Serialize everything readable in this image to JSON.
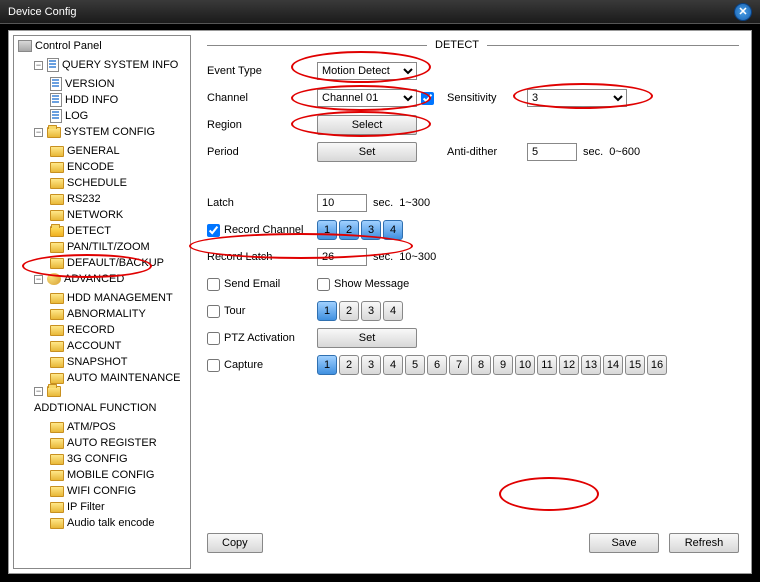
{
  "window": {
    "title": "Device Config"
  },
  "tree": {
    "root": "Control Panel",
    "groups": [
      {
        "label": "QUERY SYSTEM INFO",
        "icon": "page",
        "children": [
          "VERSION",
          "HDD INFO",
          "LOG"
        ]
      },
      {
        "label": "SYSTEM CONFIG",
        "icon": "folder",
        "children": [
          "GENERAL",
          "ENCODE",
          "SCHEDULE",
          "RS232",
          "NETWORK",
          "DETECT",
          "PAN/TILT/ZOOM",
          "DEFAULT/BACKUP"
        ]
      },
      {
        "label": "ADVANCED",
        "icon": "adv",
        "children": [
          "HDD MANAGEMENT",
          "ABNORMALITY",
          "RECORD",
          "ACCOUNT",
          "SNAPSHOT",
          "AUTO MAINTENANCE"
        ]
      },
      {
        "label": "ADDTIONAL FUNCTION",
        "icon": "folder",
        "children": [
          "ATM/POS",
          "AUTO REGISTER",
          "3G CONFIG",
          "MOBILE CONFIG",
          "WIFI CONFIG",
          "IP Filter",
          "Audio talk encode"
        ]
      }
    ]
  },
  "detect": {
    "heading": "DETECT",
    "labels": {
      "eventType": "Event Type",
      "channel": "Channel",
      "sensitivity": "Sensitivity",
      "region": "Region",
      "period": "Period",
      "antiDither": "Anti-dither",
      "sec": "sec.",
      "antiDitherRange": "0~600",
      "latch": "Latch",
      "latchRange": "1~300",
      "recordChannel": "Record Channel",
      "recordLatch": "Record Latch",
      "recordLatchRange": "10~300",
      "sendEmail": "Send Email",
      "showMessage": "Show Message",
      "tour": "Tour",
      "ptz": "PTZ Activation",
      "capture": "Capture"
    },
    "values": {
      "eventType": "Motion Detect",
      "channel": "Channel 01",
      "channelChecked": true,
      "sensitivity": "3",
      "regionBtn": "Select",
      "periodBtn": "Set",
      "antiDither": "5",
      "latch": "10",
      "recordChannelChecked": true,
      "recordChannels": [
        "1",
        "2",
        "3",
        "4"
      ],
      "recordChannelsSelected": [
        true,
        true,
        true,
        true
      ],
      "recordLatch": "26",
      "sendEmail": false,
      "showMessage": false,
      "tour": false,
      "tourChannels": [
        "1",
        "2",
        "3",
        "4"
      ],
      "tourSelected": [
        true,
        false,
        false,
        false
      ],
      "ptz": false,
      "ptzBtn": "Set",
      "capture": false,
      "captureChannels": [
        "1",
        "2",
        "3",
        "4",
        "5",
        "6",
        "7",
        "8",
        "9",
        "10",
        "11",
        "12",
        "13",
        "14",
        "15",
        "16"
      ],
      "captureSelected": [
        true,
        false,
        false,
        false,
        false,
        false,
        false,
        false,
        false,
        false,
        false,
        false,
        false,
        false,
        false,
        false
      ]
    },
    "buttons": {
      "copy": "Copy",
      "save": "Save",
      "refresh": "Refresh"
    }
  }
}
